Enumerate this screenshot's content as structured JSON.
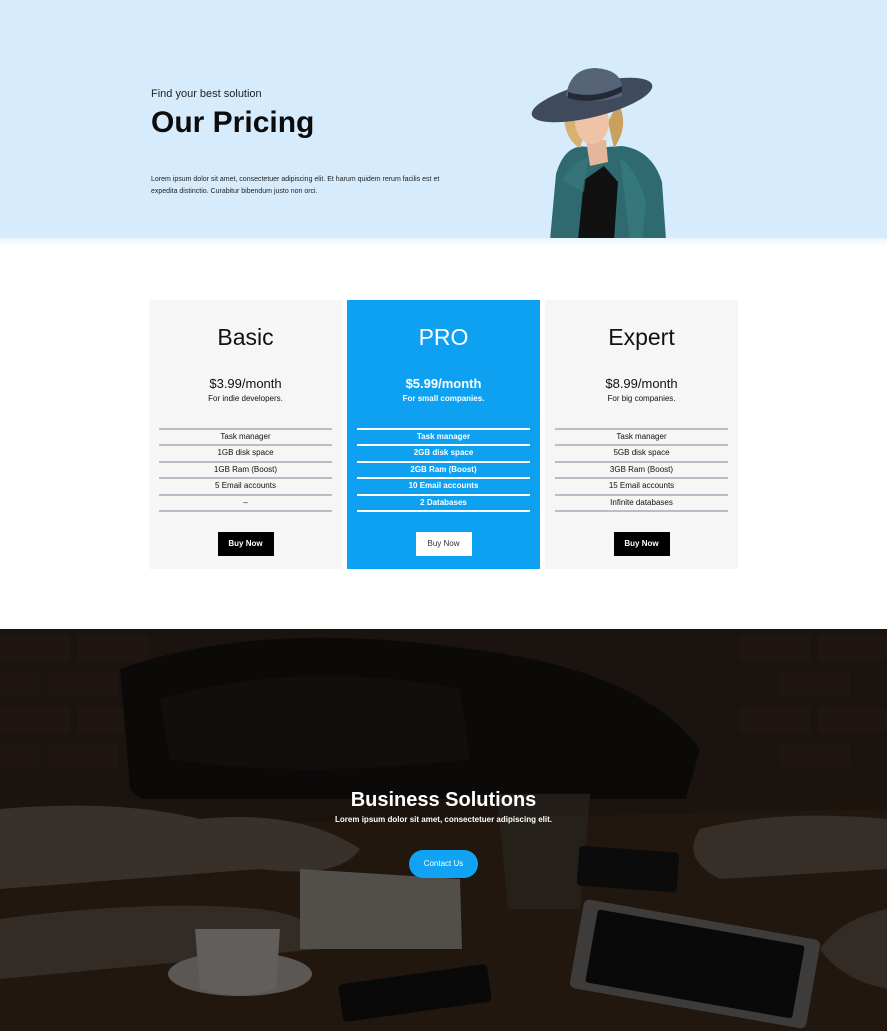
{
  "hero": {
    "subtitle": "Find your best solution",
    "title": "Our Pricing",
    "text": "Lorem ipsum dolor sit amet, consectetuer adipiscing elit. Et harum quidem rerum facilis est et expedita distinctio. Curabitur bibendum justo non orci."
  },
  "pricing": [
    {
      "name": "Basic",
      "price": "$3.99/month",
      "for": "For indie developers.",
      "features": [
        "Task manager",
        "1GB disk space",
        "1GB Ram (Boost)",
        "5 Email accounts",
        "–"
      ],
      "button": "Buy Now"
    },
    {
      "name": "PRO",
      "price": "$5.99/month",
      "for": "For small companies.",
      "features": [
        "Task manager",
        "2GB disk space",
        "2GB Ram (Boost)",
        "10 Email accounts",
        "2 Databases"
      ],
      "button": "Buy Now"
    },
    {
      "name": "Expert",
      "price": "$8.99/month",
      "for": "For big companies.",
      "features": [
        "Task manager",
        "5GB disk space",
        "3GB Ram (Boost)",
        "15 Email accounts",
        "Infinite databases"
      ],
      "button": "Buy Now"
    }
  ],
  "business": {
    "title": "Business Solutions",
    "text": "Lorem ipsum dolor sit amet, consectetuer adipiscing elit.",
    "button": "Contact Us"
  },
  "colors": {
    "hero_bg": "#d6ecfd",
    "accent": "#0ea1f2",
    "dark_button": "#000000"
  }
}
